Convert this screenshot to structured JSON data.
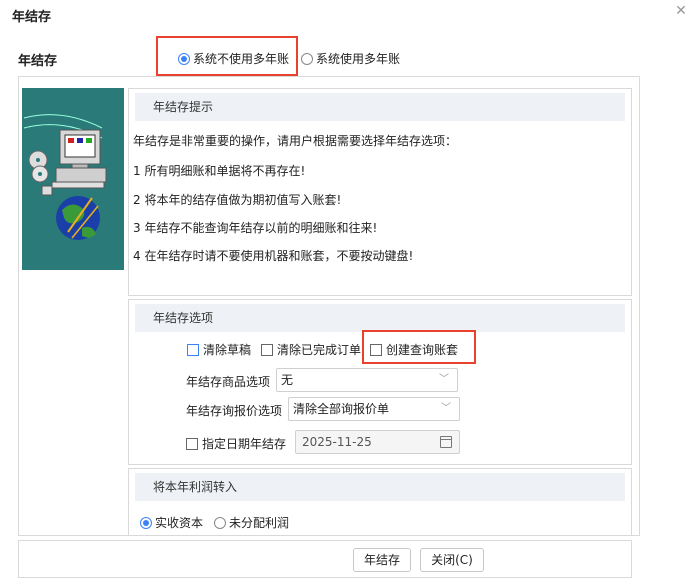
{
  "dialog": {
    "title": "年结存"
  },
  "top": {
    "label": "年结存",
    "options": [
      {
        "label": "系统不使用多年账",
        "checked": true
      },
      {
        "label": "系统使用多年账",
        "checked": false
      }
    ]
  },
  "tips": {
    "header": "年结存提示",
    "lines": [
      "年结存是非常重要的操作，请用户根据需要选择年结存选项：",
      "1 所有明细账和单据将不再存在!",
      "2 将本年的结存值做为期初值写入账套!",
      "3 年结存不能查询年结存以前的明细账和往来!",
      "4 在年结存时请不要使用机器和账套，不要按动键盘!"
    ]
  },
  "options": {
    "header": "年结存选项",
    "checkboxes": [
      {
        "label": "清除草稿",
        "checked": false
      },
      {
        "label": "清除已完成订单",
        "checked": false
      },
      {
        "label": "创建查询账套",
        "checked": false
      }
    ],
    "goods_label": "年结存商品选项",
    "goods_value": "无",
    "quote_label": "年结存询报价选项",
    "quote_value": "清除全部询报价单",
    "date_label": "指定日期年结存",
    "date_value": "2025-11-25"
  },
  "profit": {
    "header": "将本年利润转入",
    "options": [
      {
        "label": "实收资本",
        "checked": true
      },
      {
        "label": "未分配利润",
        "checked": false
      }
    ]
  },
  "footer": {
    "confirm": "年结存",
    "close": "关闭(C)"
  },
  "colors": {
    "highlight": "#e8412c",
    "accent": "#3b82f6",
    "image_bg": "#2a7a7a"
  }
}
